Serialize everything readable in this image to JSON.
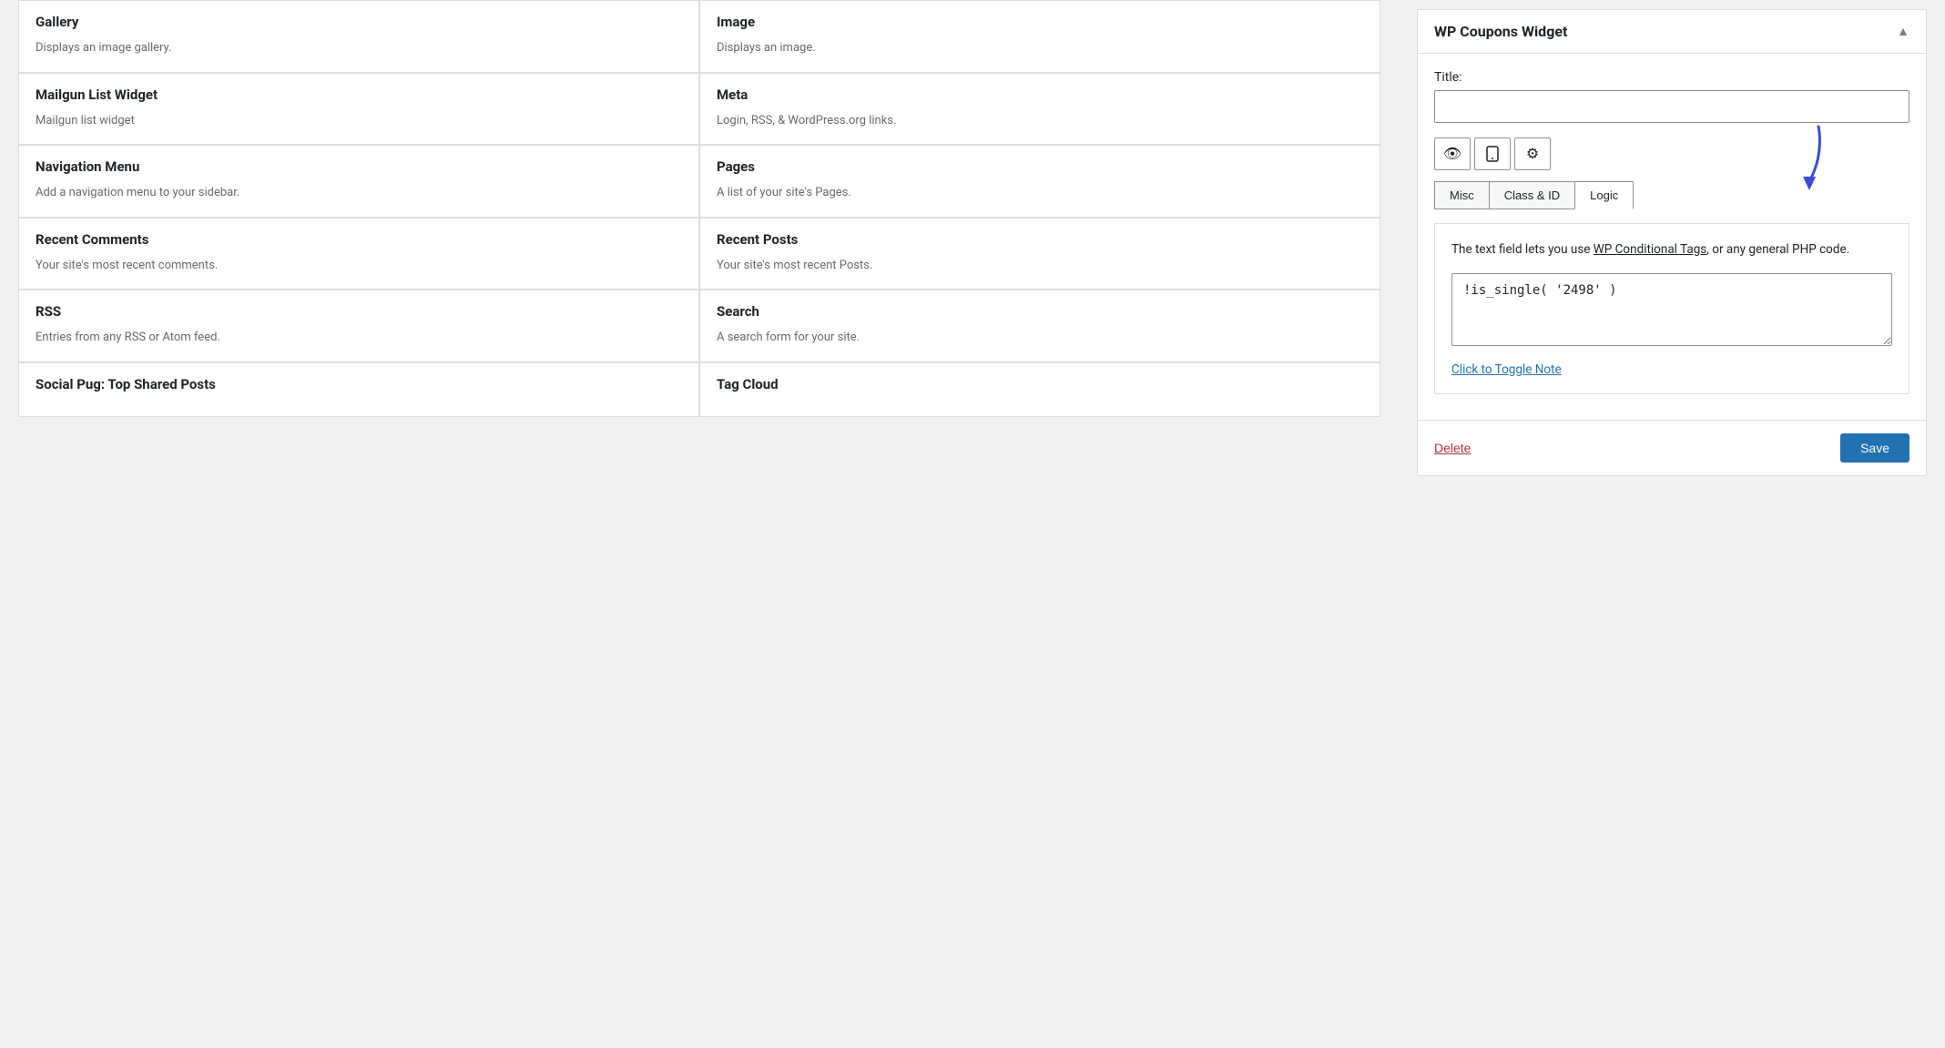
{
  "left_panel": {
    "widgets": [
      {
        "id": "gallery",
        "title": "Gallery",
        "description": "Displays an image gallery.",
        "col": 0
      },
      {
        "id": "image",
        "title": "Image",
        "description": "Displays an image.",
        "col": 1
      },
      {
        "id": "mailgun-list-widget",
        "title": "Mailgun List Widget",
        "description": "Mailgun list widget",
        "col": 0
      },
      {
        "id": "meta",
        "title": "Meta",
        "description": "Login, RSS, & WordPress.org links.",
        "col": 1
      },
      {
        "id": "navigation-menu",
        "title": "Navigation Menu",
        "description": "Add a navigation menu to your sidebar.",
        "col": 0
      },
      {
        "id": "pages",
        "title": "Pages",
        "description": "A list of your site's Pages.",
        "col": 1
      },
      {
        "id": "recent-comments",
        "title": "Recent Comments",
        "description": "Your site's most recent comments.",
        "col": 0
      },
      {
        "id": "recent-posts",
        "title": "Recent Posts",
        "description": "Your site's most recent Posts.",
        "col": 1
      },
      {
        "id": "rss",
        "title": "RSS",
        "description": "Entries from any RSS or Atom feed.",
        "col": 0
      },
      {
        "id": "search",
        "title": "Search",
        "description": "A search form for your site.",
        "col": 1
      },
      {
        "id": "social-pug",
        "title": "Social Pug: Top Shared Posts",
        "description": "",
        "col": 0
      },
      {
        "id": "tag-cloud",
        "title": "Tag Cloud",
        "description": "",
        "col": 1
      }
    ]
  },
  "right_panel": {
    "widget_title": "WP Coupons Widget",
    "title_label": "Title:",
    "title_placeholder": "",
    "title_value": "",
    "icons": {
      "eye": "👁",
      "mobile": "📱",
      "gear": "⚙"
    },
    "tabs": [
      {
        "id": "misc",
        "label": "Misc",
        "active": false
      },
      {
        "id": "class-id",
        "label": "Class & ID",
        "active": false
      },
      {
        "id": "logic",
        "label": "Logic",
        "active": true
      }
    ],
    "logic": {
      "description_part1": "The text field lets you use ",
      "description_link": "WP Conditional Tags",
      "description_part2": ", or any general PHP code.",
      "code_value": "!is_single( '2498' )",
      "toggle_link": "Click to Toggle Note"
    },
    "footer": {
      "delete_label": "Delete",
      "save_label": "Save"
    }
  }
}
